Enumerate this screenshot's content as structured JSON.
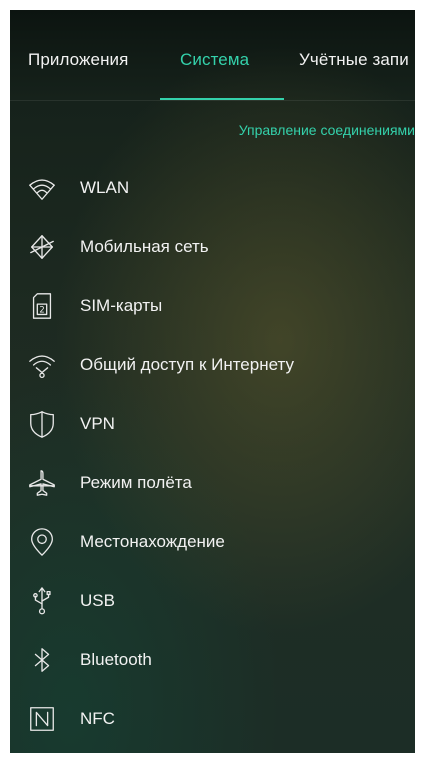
{
  "tabs": [
    {
      "label": "Приложения",
      "active": false
    },
    {
      "label": "Система",
      "active": true
    },
    {
      "label": "Учётные запи",
      "active": false
    }
  ],
  "section": {
    "title": "Управление соединениями"
  },
  "menu_items": [
    {
      "label": "WLAN",
      "icon": "wifi-icon"
    },
    {
      "label": "Мобильная сеть",
      "icon": "mobile-network-icon"
    },
    {
      "label": "SIM-карты",
      "icon": "sim-card-icon"
    },
    {
      "label": "Общий доступ к Интернету",
      "icon": "hotspot-icon"
    },
    {
      "label": "VPN",
      "icon": "shield-icon"
    },
    {
      "label": "Режим полёта",
      "icon": "airplane-icon"
    },
    {
      "label": "Местонахождение",
      "icon": "location-pin-icon"
    },
    {
      "label": "USB",
      "icon": "usb-icon"
    },
    {
      "label": "Bluetooth",
      "icon": "bluetooth-icon"
    },
    {
      "label": "NFC",
      "icon": "nfc-icon"
    }
  ],
  "sim_icon_text": "2",
  "colors": {
    "accent": "#34d1ab",
    "text": "#f2f2f2",
    "background": "#1f2d24"
  }
}
